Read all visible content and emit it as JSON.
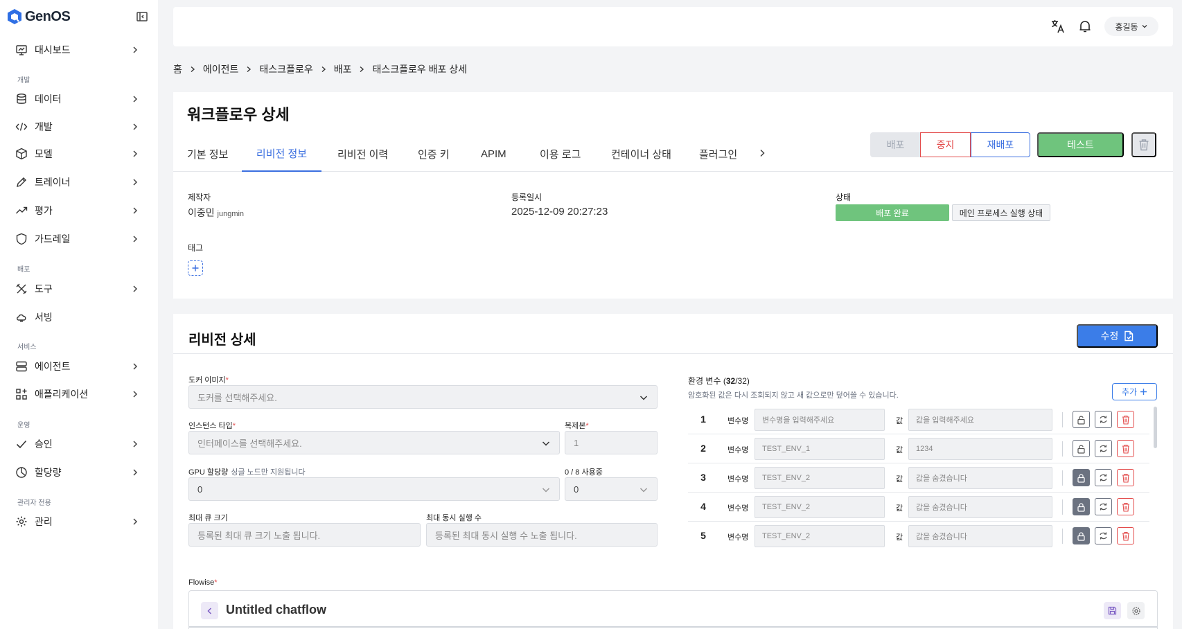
{
  "brand": {
    "name": "GenOS"
  },
  "sidebar": {
    "items": [
      {
        "label": "대시보드",
        "icon": "monitor-icon",
        "chevron": true
      },
      {
        "label": "데이터",
        "icon": "database-icon",
        "chevron": true
      },
      {
        "label": "개발",
        "icon": "code-icon",
        "chevron": true
      },
      {
        "label": "모델",
        "icon": "cube-icon",
        "chevron": true
      },
      {
        "label": "트레이너",
        "icon": "pencil-icon",
        "chevron": true
      },
      {
        "label": "평가",
        "icon": "trend-icon",
        "chevron": true
      },
      {
        "label": "가드레일",
        "icon": "shield-icon",
        "chevron": true
      },
      {
        "label": "도구",
        "icon": "tools-icon",
        "chevron": true
      },
      {
        "label": "서빙",
        "icon": "cloud-icon",
        "chevron": false
      },
      {
        "label": "에이전트",
        "icon": "server-icon",
        "chevron": true
      },
      {
        "label": "애플리케이션",
        "icon": "apps-icon",
        "chevron": true
      },
      {
        "label": "승인",
        "icon": "check-icon",
        "chevron": true
      },
      {
        "label": "할당량",
        "icon": "pie-icon",
        "chevron": true
      },
      {
        "label": "관리",
        "icon": "gear-icon",
        "chevron": true
      }
    ],
    "groups": [
      "개발",
      "배포",
      "서비스",
      "운영",
      "관리자 전용"
    ]
  },
  "header": {
    "user_name": "홍길동"
  },
  "breadcrumb": [
    "홈",
    "에이전트",
    "태스크플로우",
    "배포",
    "태스크플로우 배포 상세"
  ],
  "detail": {
    "title": "워크플로우 상세",
    "tabs": [
      "기본 정보",
      "리비전 정보",
      "리비전 이력",
      "인증 키",
      "APIM",
      "이용 로그",
      "컨테이너 상태",
      "플러그인"
    ],
    "active_tab": "리비전 정보",
    "actions": {
      "deploy": "배포",
      "stop": "중지",
      "redeploy": "재배포",
      "test": "테스트"
    },
    "creator_label": "제작자",
    "creator_name": "이중민",
    "creator_id": "jungmin",
    "registered_label": "등록일시",
    "registered_at": "2025-12-09 20:27:23",
    "status_label": "상태",
    "status_value": "배포 완료",
    "main_process_label": "메인 프로세스 실행 상태",
    "tag_label": "태그"
  },
  "revision": {
    "title": "리비전 상세",
    "edit_label": "수정",
    "docker_label": "도커 이미지",
    "docker_placeholder": "도커를 선택해주세요.",
    "instance_label": "인스턴스 타입",
    "instance_placeholder": "인터페이스를 선택해주세요.",
    "replica_label": "복제본",
    "replica_value": "1",
    "gpu_label": "GPU 할당량",
    "gpu_hint": "싱글 노드만 지원됩니다",
    "gpu_value": "0",
    "usage_label": "0 / 8 사용중",
    "usage_value": "0",
    "queue_label": "최대 큐 크기",
    "queue_placeholder": "등록된 최대 큐 크기 노출 됩니다.",
    "concurrency_label": "최대 동시 실행 수",
    "concurrency_placeholder": "등록된 최대 동시 실행 수 노출 됩니다.",
    "env": {
      "title_prefix": "환경 변수 (",
      "count": "32",
      "total": "/32)",
      "desc": "암호화된 값은 다시 조회되지 않고 새 값으로만 덮어쓸 수 있습니다.",
      "add_label": "추가",
      "key_label": "변수명",
      "value_label": "값",
      "rows": [
        {
          "index": "1",
          "key": "변수명을 입력해주세요",
          "value": "값을 입력해주세요",
          "locked": false
        },
        {
          "index": "2",
          "key": "TEST_ENV_1",
          "value": "1234",
          "locked": false
        },
        {
          "index": "3",
          "key": "TEST_ENV_2",
          "value": "값을 숨겼습니다",
          "locked": true
        },
        {
          "index": "4",
          "key": "TEST_ENV_2",
          "value": "값을 숨겼습니다",
          "locked": true
        },
        {
          "index": "5",
          "key": "TEST_ENV_2",
          "value": "값을 숨겼습니다",
          "locked": true
        }
      ]
    },
    "flowise_label": "Flowise",
    "flowise_title": "Untitled chatflow"
  },
  "colors": {
    "accent": "#3b6fe0",
    "success": "#6fc47d",
    "danger": "#e34b4b"
  }
}
